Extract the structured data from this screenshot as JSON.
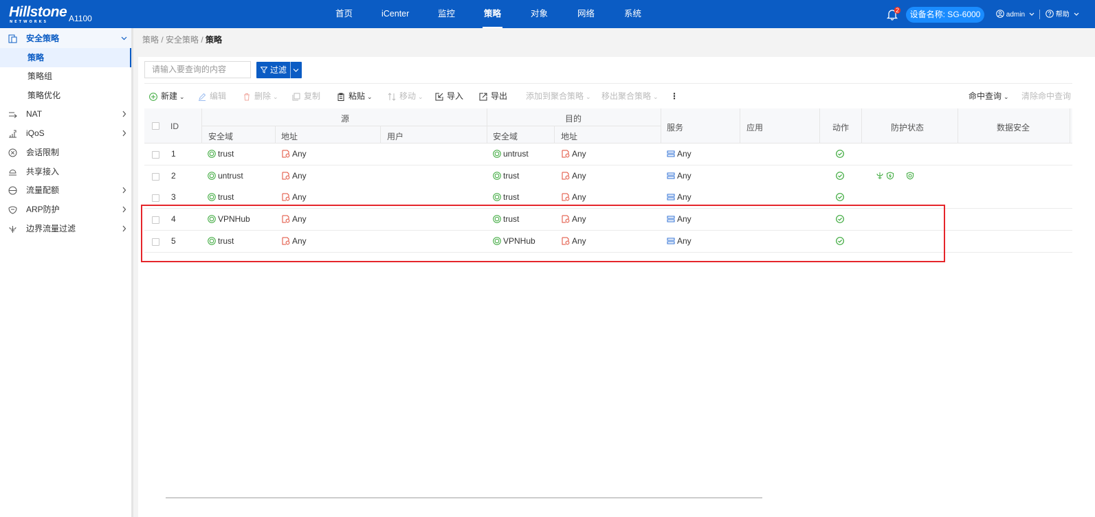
{
  "topbar": {
    "logo_text": "Hillstone",
    "logo_sub": "NETWORKS",
    "model": "A1100",
    "nav": [
      "首页",
      "iCenter",
      "监控",
      "策略",
      "对象",
      "网络",
      "系统"
    ],
    "active_nav": "策略",
    "bell_count": "2",
    "device_label": "设备名称: SG-6000",
    "user": "admin",
    "help": "帮助"
  },
  "sidebar": {
    "items": [
      {
        "label": "安全策略",
        "icon": "policy-icon"
      },
      {
        "label": "策略"
      },
      {
        "label": "策略组"
      },
      {
        "label": "策略优化"
      },
      {
        "label": "NAT",
        "icon": "nat-icon"
      },
      {
        "label": "iQoS",
        "icon": "qos-icon"
      },
      {
        "label": "会话限制",
        "icon": "session-limit-icon"
      },
      {
        "label": "共享接入",
        "icon": "shared-access-icon"
      },
      {
        "label": "流量配额",
        "icon": "quota-icon"
      },
      {
        "label": "ARP防护",
        "icon": "arp-icon"
      },
      {
        "label": "边界流量过滤",
        "icon": "border-filter-icon"
      }
    ]
  },
  "breadcrumb": {
    "part1": "策略 / 安全策略 / ",
    "current": "策略"
  },
  "search": {
    "placeholder": "请输入要查询的内容"
  },
  "filter": {
    "label": "过滤"
  },
  "toolbar": {
    "new": "新建",
    "edit": "编辑",
    "delete": "删除",
    "copy": "复制",
    "paste": "粘贴",
    "move": "移动",
    "import": "导入",
    "export": "导出",
    "add_to_merge": "添加到聚合策略",
    "remove_from_merge": "移出聚合策略",
    "more": "⋮",
    "hit_query": "命中查询",
    "clear_hit": "清除命中查询"
  },
  "table": {
    "headers": {
      "id": "ID",
      "source": "源",
      "dest": "目的",
      "src_zone": "安全域",
      "src_addr": "地址",
      "src_user": "用户",
      "dst_zone": "安全域",
      "dst_addr": "地址",
      "service": "服务",
      "app": "应用",
      "action": "动作",
      "protect": "防护状态",
      "data_security": "数据安全"
    },
    "rows": [
      {
        "id": "1",
        "src_zone": "trust",
        "src_addr": "Any",
        "dst_zone": "untrust",
        "dst_addr": "Any",
        "service": "Any"
      },
      {
        "id": "2",
        "src_zone": "untrust",
        "src_addr": "Any",
        "dst_zone": "trust",
        "dst_addr": "Any",
        "service": "Any"
      },
      {
        "id": "3",
        "src_zone": "trust",
        "src_addr": "Any",
        "dst_zone": "trust",
        "dst_addr": "Any",
        "service": "Any"
      },
      {
        "id": "4",
        "src_zone": "VPNHub",
        "src_addr": "Any",
        "dst_zone": "trust",
        "dst_addr": "Any",
        "service": "Any"
      },
      {
        "id": "5",
        "src_zone": "trust",
        "src_addr": "Any",
        "dst_zone": "VPNHub",
        "dst_addr": "Any",
        "service": "Any"
      }
    ]
  },
  "colors": {
    "brand": "#0b5cc4",
    "zone": "#3aa83a",
    "address": "#e04a35",
    "service": "#2c6fd6",
    "action": "#3aa83a",
    "highlight": "#e5252a"
  }
}
